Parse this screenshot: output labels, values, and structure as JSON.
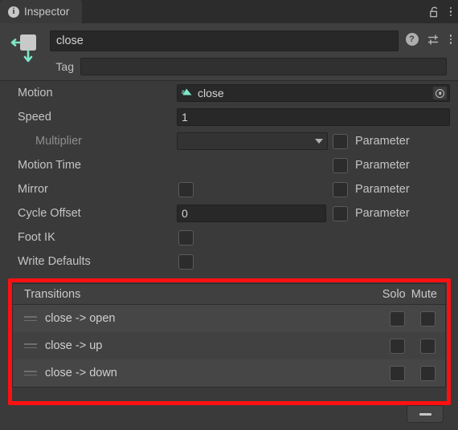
{
  "window": {
    "tab_label": "Inspector",
    "tab_icon": "info-icon",
    "lock_icon": "unlock-icon",
    "menu_icon": "kebab-menu-icon"
  },
  "object_header": {
    "state_icon": "animator-state-icon",
    "name_value": "close",
    "help_icon": "help-icon",
    "preset_icon": "preset-sliders-icon",
    "menu_icon": "kebab-menu-icon",
    "tag_label": "Tag",
    "tag_value": ""
  },
  "properties": [
    {
      "label": "Motion",
      "value": "close",
      "control": "object-field"
    },
    {
      "label": "Speed",
      "value": "1",
      "control": "number-field"
    },
    {
      "label": "Multiplier",
      "value": "",
      "control": "dropdown",
      "dimmed": true,
      "parameter_label": "Parameter",
      "parameter_checked": false
    },
    {
      "label": "Motion Time",
      "value": "",
      "control": "none",
      "parameter_label": "Parameter",
      "parameter_checked": false
    },
    {
      "label": "Mirror",
      "value": "",
      "control": "checkbox",
      "checked": false,
      "parameter_label": "Parameter",
      "parameter_checked": false
    },
    {
      "label": "Cycle Offset",
      "value": "0",
      "control": "number-field",
      "parameter_label": "Parameter",
      "parameter_checked": false
    },
    {
      "label": "Foot IK",
      "value": "",
      "control": "checkbox",
      "checked": false
    },
    {
      "label": "Write Defaults",
      "value": "",
      "control": "checkbox",
      "checked": false
    }
  ],
  "transitions": {
    "header_label": "Transitions",
    "solo_label": "Solo",
    "mute_label": "Mute",
    "rows": [
      {
        "name": "close -> open",
        "solo": false,
        "mute": false
      },
      {
        "name": "close -> up",
        "solo": false,
        "mute": false
      },
      {
        "name": "close -> down",
        "solo": false,
        "mute": false
      }
    ]
  },
  "footer": {
    "remove_label": "−"
  },
  "colors": {
    "background": "#3a3a3a",
    "panel": "#3f3f3f",
    "field": "#282828",
    "accent_teal": "#7fe6c8",
    "highlight_red": "#fb1111",
    "text": "#c4c4c4"
  }
}
